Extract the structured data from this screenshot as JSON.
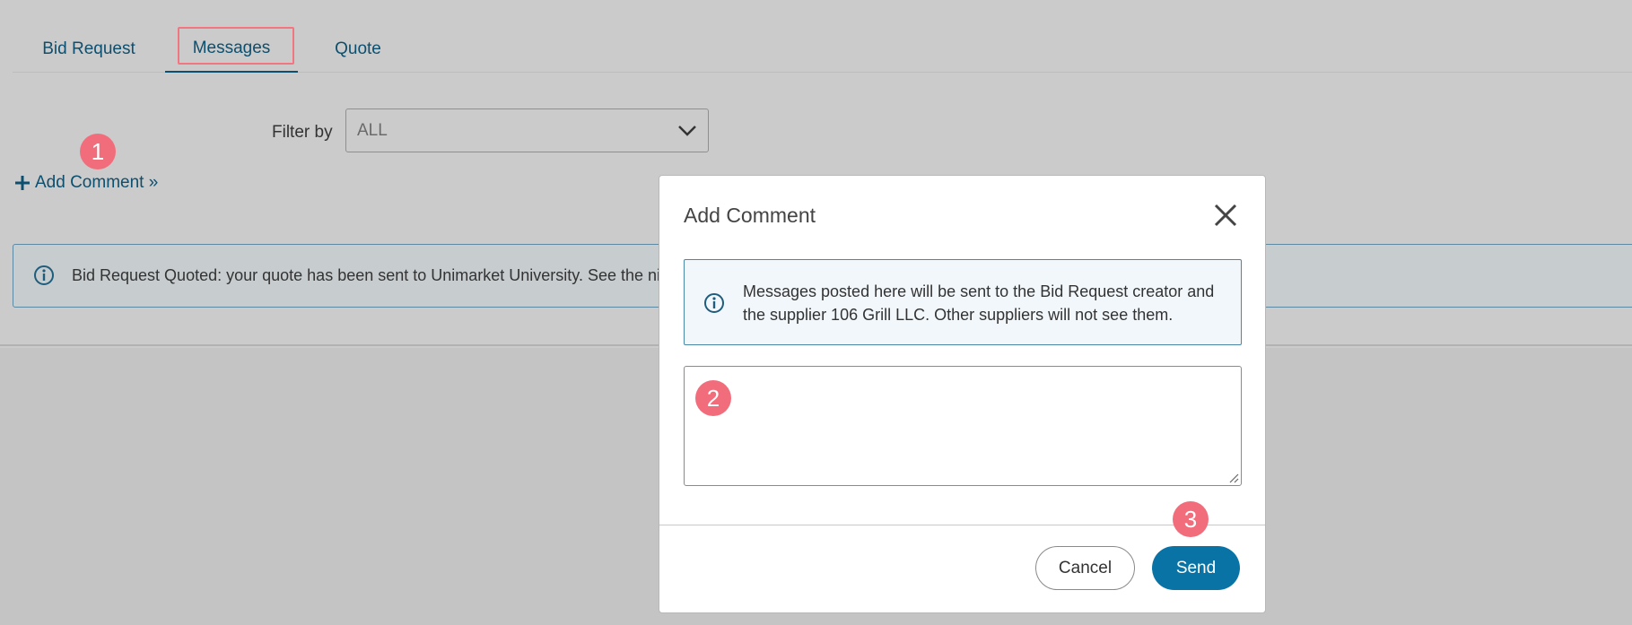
{
  "tabs": [
    {
      "label": "Bid Request"
    },
    {
      "label": "Messages"
    },
    {
      "label": "Quote"
    }
  ],
  "filter": {
    "label": "Filter by",
    "value": "ALL"
  },
  "add_comment": {
    "label": "Add Comment »"
  },
  "alert": {
    "text": "Bid Request Quoted: your quote has been sent to Unimarket University. See the                                                                                                    niversity in the Messages tab."
  },
  "modal": {
    "title": "Add Comment",
    "info": "Messages posted here will be sent to the Bid Request creator and the supplier 106 Grill LLC. Other suppliers will not see them.",
    "comment_value": "",
    "cancel_label": "Cancel",
    "send_label": "Send"
  },
  "steps": [
    "1",
    "2",
    "3"
  ],
  "colors": {
    "accent": "#0a73a6",
    "link": "#0d4f6f",
    "step_badge": "#f26d7c",
    "backdrop": "#cbcbcb"
  }
}
